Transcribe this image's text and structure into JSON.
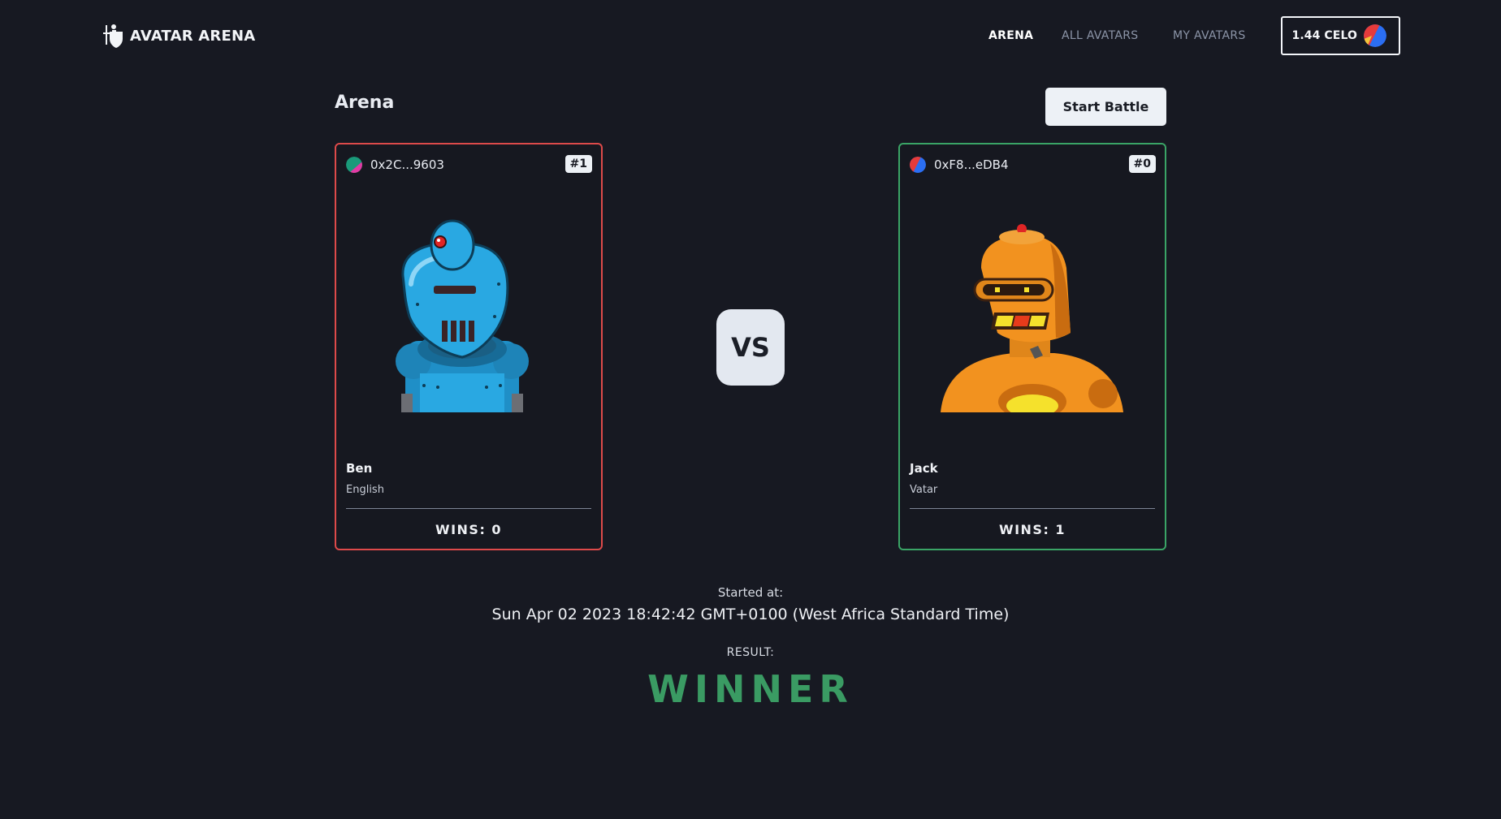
{
  "header": {
    "brand_name": "AVATAR ARENA",
    "nav": [
      {
        "label": "ARENA",
        "active": true
      },
      {
        "label": "ALL AVATARS",
        "active": false
      },
      {
        "label": "MY AVATARS",
        "active": false
      }
    ],
    "wallet_balance": "1.44 CELO"
  },
  "arena": {
    "title": "Arena",
    "start_button": "Start Battle",
    "vs_label": "VS",
    "players": [
      {
        "address": "0x2C...9603",
        "token": "#1",
        "name": "Ben",
        "language": "English",
        "wins": "WINS: 0",
        "border_color": "#dd4a4a",
        "robot_color": "#27a6e0"
      },
      {
        "address": "0xF8...eDB4",
        "token": "#0",
        "name": "Jack",
        "language": "Vatar",
        "wins": "WINS: 1",
        "border_color": "#3aa466",
        "robot_color": "#f2921f"
      }
    ]
  },
  "battle": {
    "started_label": "Started at:",
    "started_value": "Sun Apr 02 2023 18:42:42 GMT+0100 (West Africa Standard Time)",
    "result_label": "RESULT:",
    "result_value": "WINNER",
    "result_color": "#3a9b63"
  }
}
